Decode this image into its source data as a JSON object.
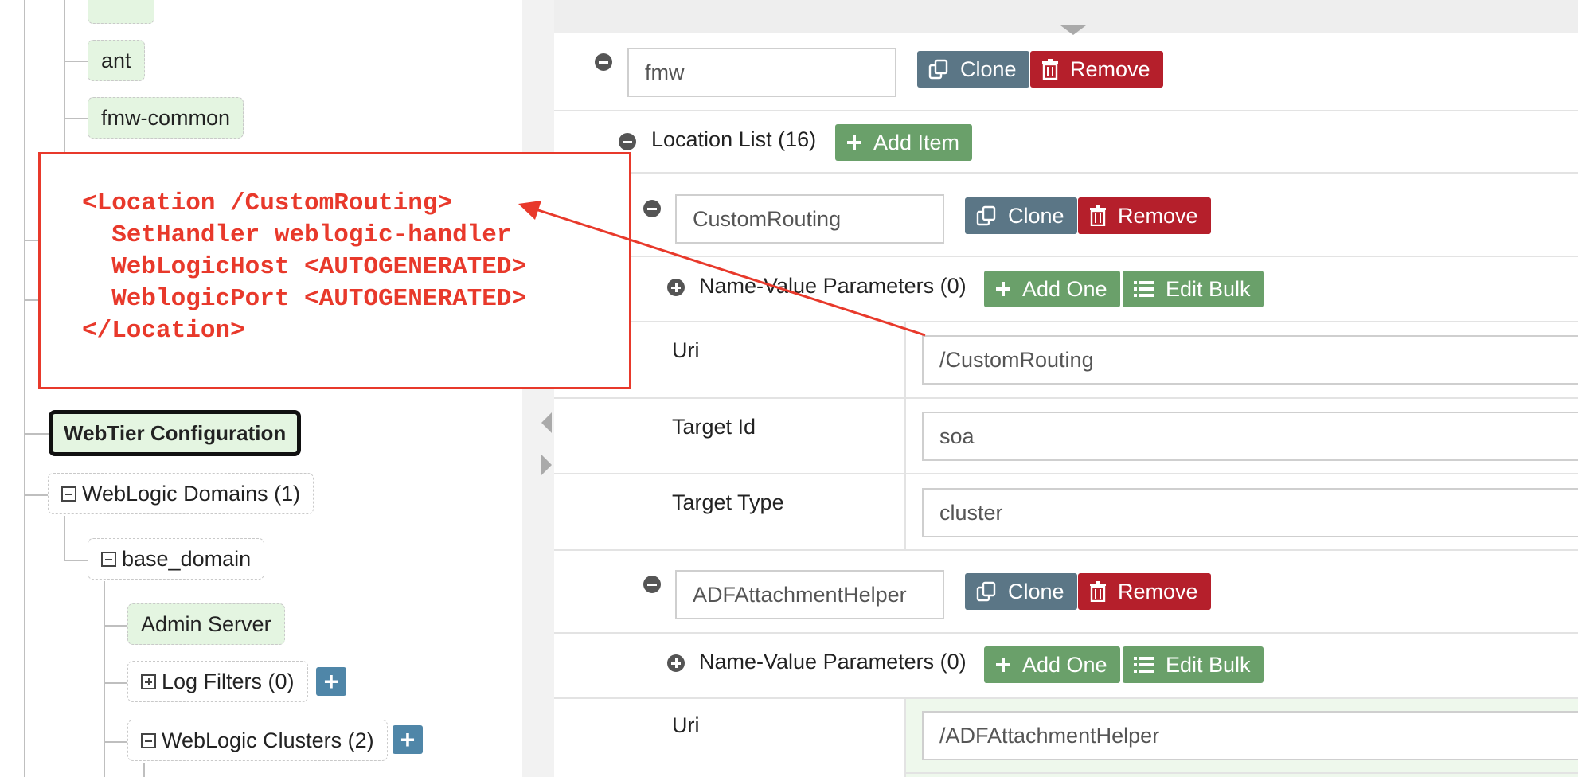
{
  "tree": {
    "ant_label": "ant",
    "fmw_common_label": "fmw-common",
    "webtier_label": "WebTier Configuration",
    "weblogic_domains_label": "WebLogic Domains (1)",
    "base_domain_label": "base_domain",
    "admin_server_label": "Admin Server",
    "log_filters_label": "Log Filters (0)",
    "weblogic_clusters_label": "WebLogic Clusters (2)",
    "add_button_symbol": "+"
  },
  "annotation": {
    "lines": [
      "<Location /CustomRouting>",
      "  SetHandler weblogic-handler",
      "  WebLogicHost <AUTOGENERATED>",
      "  WeblogicPort <AUTOGENERATED>",
      "</Location>"
    ],
    "color": "#e8392b"
  },
  "form": {
    "fmw_value": "fmw",
    "clone_label": "Clone",
    "remove_label": "Remove",
    "location_list_label": "Location List (16)",
    "add_item_label": "Add Item",
    "add_one_label": "Add One",
    "edit_bulk_label": "Edit Bulk",
    "name_value_label": "Name-Value Parameters (0)",
    "uri_label": "Uri",
    "target_id_label": "Target Id",
    "target_type_label": "Target Type",
    "locations": [
      {
        "name": "CustomRouting",
        "uri": "/CustomRouting",
        "target_id": "soa",
        "target_type": "cluster"
      },
      {
        "name": "ADFAttachmentHelper",
        "uri": "/ADFAttachmentHelper"
      }
    ]
  },
  "colors": {
    "clone": "#5b7686",
    "remove": "#b51f2b",
    "add": "#6aa06a",
    "tree_add": "#4f86a8",
    "highlight": "#e4f5e1"
  }
}
